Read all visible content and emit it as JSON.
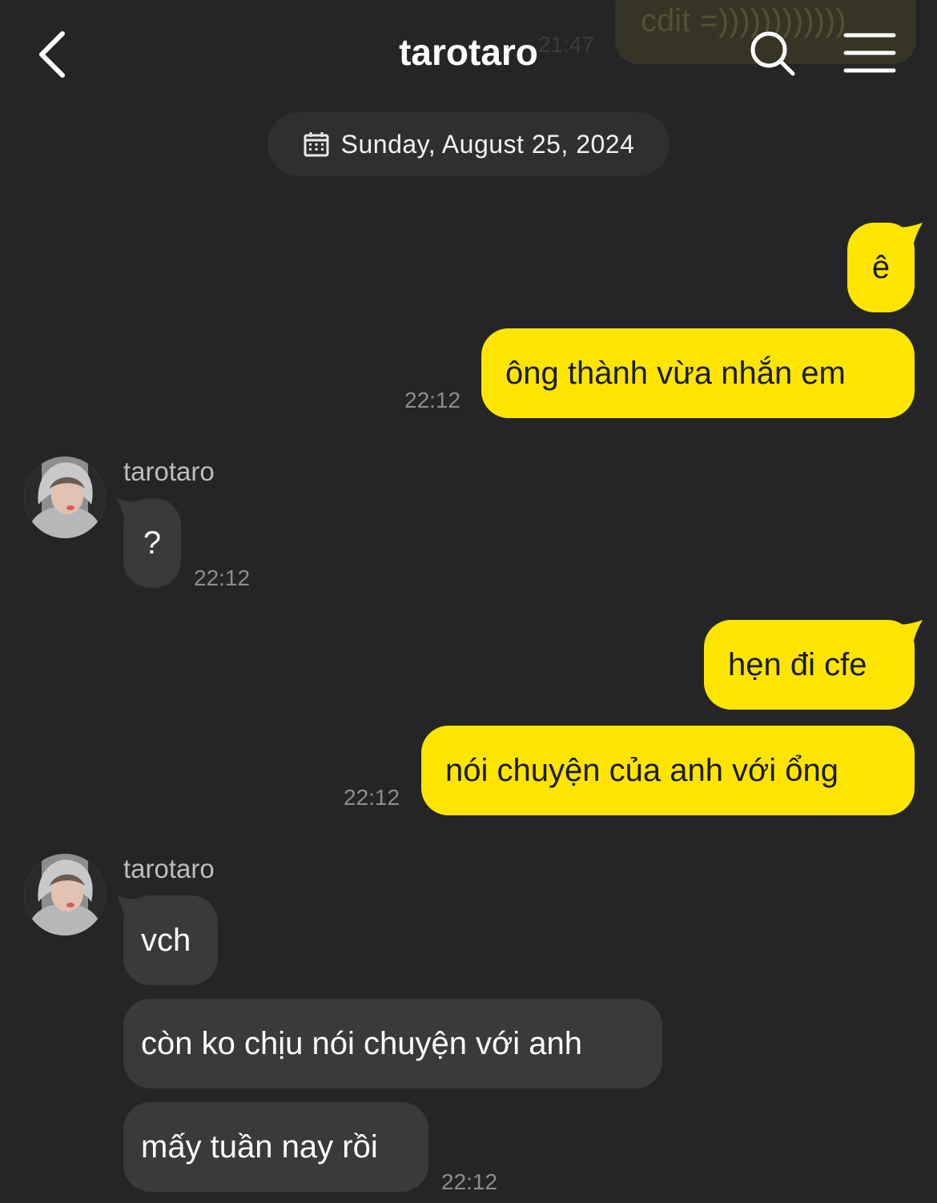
{
  "ghost": {
    "text": "cdit =))))))))))))",
    "time": "21:47"
  },
  "header": {
    "title": "tarotaro",
    "icons": [
      "back-icon",
      "search-icon",
      "menu-icon"
    ]
  },
  "date_divider": {
    "label": "Sunday, August 25, 2024",
    "icon": "calendar-icon"
  },
  "colors": {
    "background": "#252527",
    "outgoing": "#fee500",
    "incoming": "#3a3a3c",
    "timestamp": "#8d8d91"
  },
  "messages": [
    {
      "from": "me",
      "text": "ê"
    },
    {
      "from": "me",
      "text": "ông thành vừa nhắn em",
      "time": "22:12"
    },
    {
      "from": "them",
      "sender": "tarotaro",
      "text": "?",
      "time": "22:12"
    },
    {
      "from": "me",
      "text": "hẹn đi cfe"
    },
    {
      "from": "me",
      "text": "nói chuyện của anh với ổng",
      "time": "22:12"
    },
    {
      "from": "them",
      "sender": "tarotaro",
      "text": "vch"
    },
    {
      "from": "them",
      "text": "còn ko chịu nói chuyện với anh"
    },
    {
      "from": "them",
      "text": "mấy tuần nay rồi",
      "time": "22:12"
    }
  ]
}
